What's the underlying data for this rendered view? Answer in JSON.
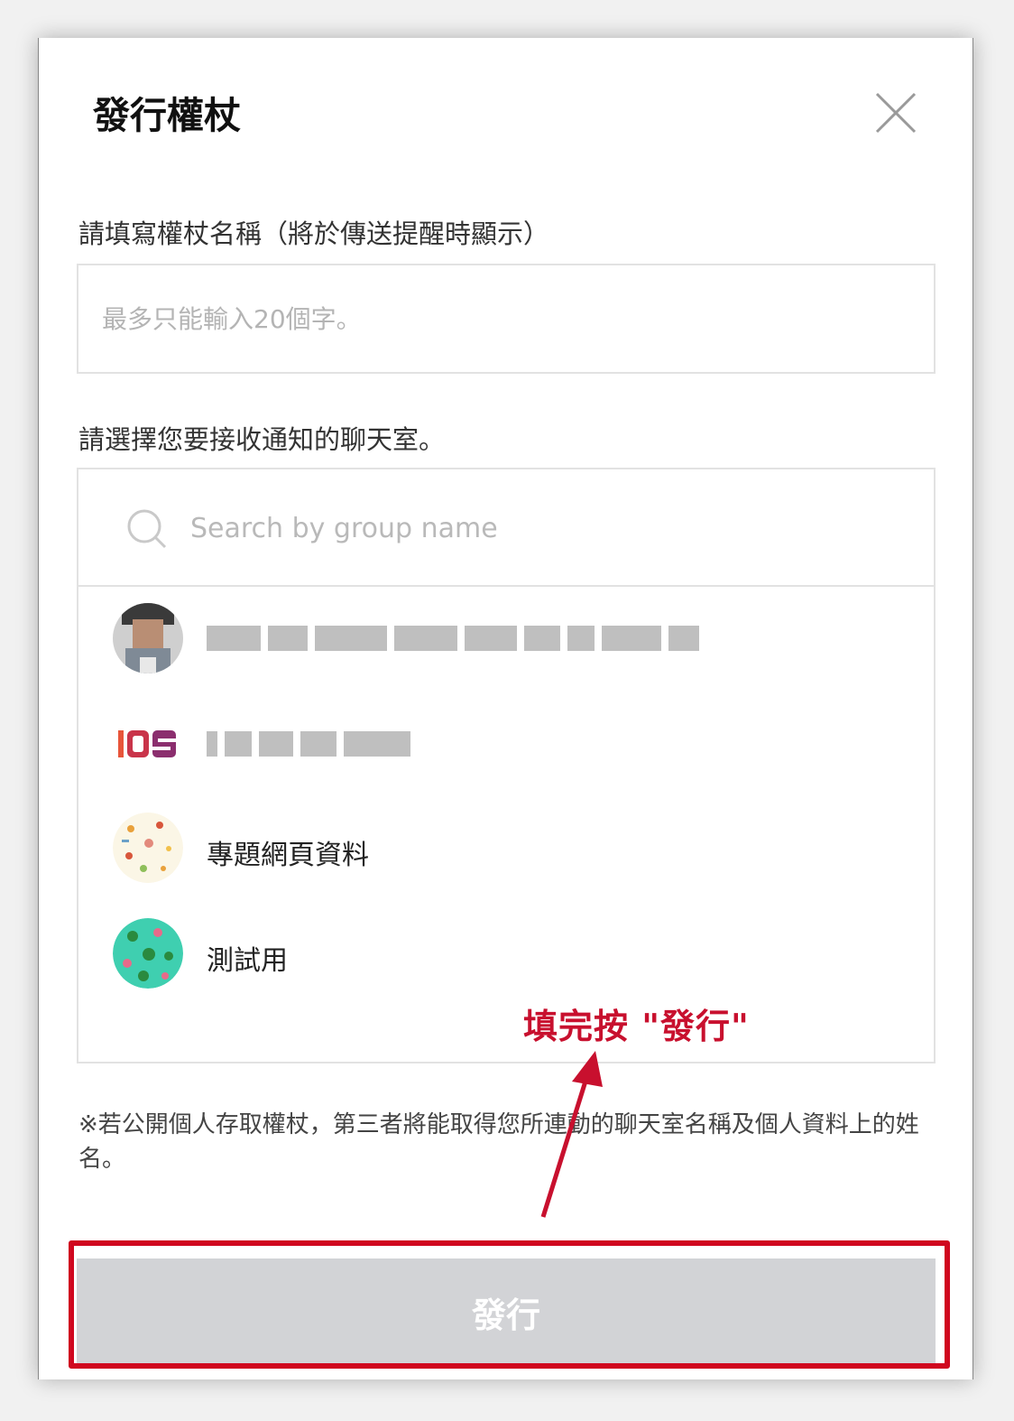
{
  "dialog": {
    "title": "發行權杖",
    "close_icon": "close-icon"
  },
  "token_name": {
    "label": "請填寫權杖名稱（將於傳送提醒時顯示）",
    "placeholder": "最多只能輸入20個字。",
    "value": ""
  },
  "room_select": {
    "label": "請選擇您要接收通知的聊天室。",
    "search_placeholder": "Search by group name",
    "search_icon": "search-icon",
    "rooms": [
      {
        "name": "",
        "avatar": "person-photo-avatar",
        "name_obscured": true
      },
      {
        "name": "",
        "avatar": "ios-logo-avatar",
        "name_obscured": true
      },
      {
        "name": "專題網頁資料",
        "avatar": "pattern-avatar"
      },
      {
        "name": "測試用",
        "avatar": "green-pattern-avatar"
      }
    ]
  },
  "notice": "※若公開個人存取權杖，第三者將能取得您所連動的聊天室名稱及個人資料上的姓名。",
  "publish_button": {
    "label": "發行",
    "enabled": false
  },
  "annotation": {
    "text": "填完按 \"發行\"",
    "color": "#c8102e"
  }
}
